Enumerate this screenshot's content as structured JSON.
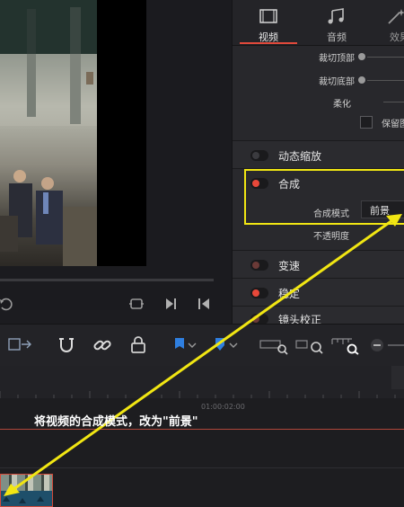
{
  "inspector": {
    "tabs": [
      {
        "label": "视频",
        "icon": "film-icon",
        "active": true
      },
      {
        "label": "音频",
        "icon": "music-note-icon",
        "active": false
      },
      {
        "label": "效果",
        "icon": "magic-wand-icon",
        "active": false
      }
    ],
    "crop": {
      "crop_top_label": "裁切顶部",
      "crop_bottom_label": "裁切底部",
      "softness_label": "柔化",
      "keep_label": "保留图"
    },
    "dynamic_zoom": {
      "title": "动态缩放",
      "enabled": false
    },
    "composite": {
      "title": "合成",
      "enabled": true,
      "blend_mode_label": "合成模式",
      "blend_mode_value": "前景",
      "opacity_label": "不透明度"
    },
    "speed_change": {
      "title": "变速",
      "enabled": false
    },
    "stabilization": {
      "title": "稳定",
      "enabled": true
    },
    "lens_correction": {
      "title": "镜头校正"
    }
  },
  "timeline": {
    "timecode": "01:00:02:00"
  },
  "annotation": {
    "text": "将视频的合成模式，改为\"前景\""
  },
  "colors": {
    "accent": "#e0493b",
    "highlight": "#f1e613",
    "toggle_on": "#e8483a",
    "toggle_off": "#6b3a37"
  }
}
